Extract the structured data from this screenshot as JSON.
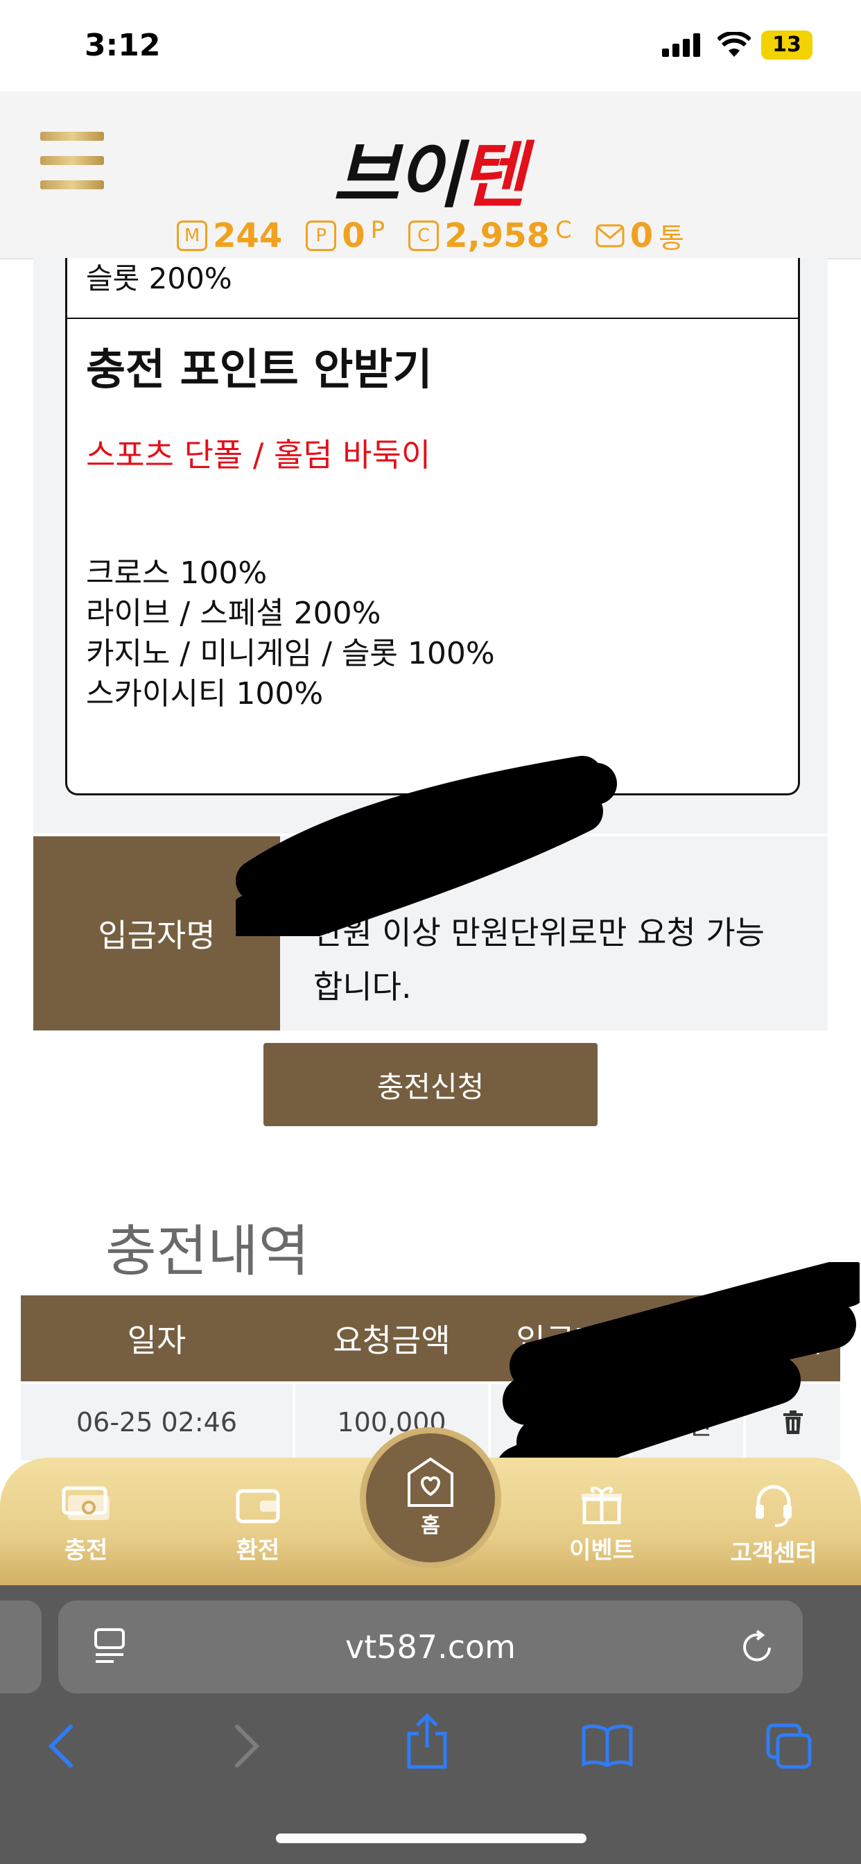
{
  "status_bar": {
    "time": "3:12",
    "battery": "13"
  },
  "header": {
    "logo_part1": "브이",
    "logo_part2": "텐",
    "wallet": [
      {
        "icon": "M",
        "value": "244",
        "unit": ""
      },
      {
        "icon": "P",
        "value": "0",
        "unit": "P"
      },
      {
        "icon": "C",
        "value": "2,958",
        "unit": "C"
      },
      {
        "icon": "mail",
        "value": "0",
        "unit": "통"
      }
    ]
  },
  "bonus": {
    "upper_partial": "슬롯 200%",
    "title": "충전 포인트 안받기",
    "highlight": "스포츠 단폴 / 홀덤 바둑이",
    "rates": [
      "크로스 100%",
      "라이브 / 스페셜 200%",
      "카지노 / 미니게임 / 슬롯 100%",
      "스카이시티 100%"
    ]
  },
  "deposit": {
    "label": "입금자명",
    "note": "만원 이상 만원단위로만 요청 가능합니다."
  },
  "charge_button": "충전신청",
  "history": {
    "title": "충전내역",
    "columns": [
      "일자",
      "요청금액",
      "입금자",
      "",
      "삭제"
    ],
    "rows": [
      {
        "date": "06-25 02:46",
        "amount": "100,000",
        "status": "승인"
      }
    ]
  },
  "bottom_nav": {
    "items": [
      "충전",
      "환전",
      "홈",
      "이벤트",
      "고객센터"
    ]
  },
  "browser": {
    "url": "vt587.com"
  },
  "colors": {
    "brown": "#765f41",
    "gold": "#e8ce8a",
    "orange": "#f0a21f",
    "red": "#e40f1a"
  }
}
